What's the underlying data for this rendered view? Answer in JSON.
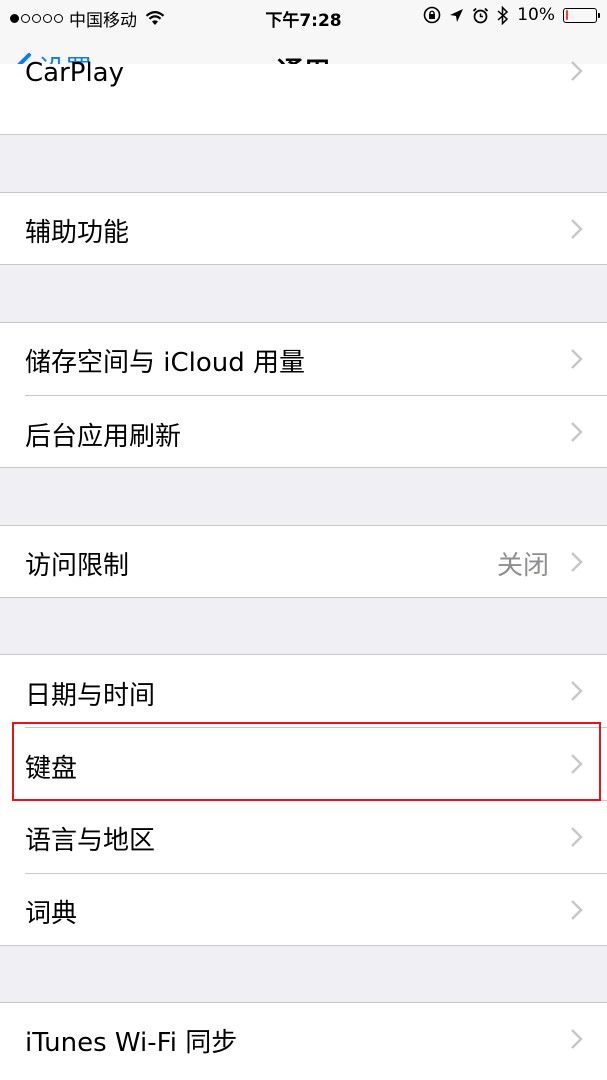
{
  "status_bar": {
    "carrier": "中国移动",
    "time": "下午7:28",
    "battery_percent": "10%",
    "battery_level": 0.1,
    "battery_color": "#ff3b30",
    "icons": [
      "wifi-icon",
      "orientation-lock-icon",
      "location-icon",
      "alarm-icon",
      "bluetooth-icon",
      "battery-icon"
    ]
  },
  "nav": {
    "back_label": "设置",
    "title": "通用"
  },
  "rows": {
    "carplay": "CarPlay",
    "accessibility": "辅助功能",
    "storage": "储存空间与 iCloud 用量",
    "background_refresh": "后台应用刷新",
    "restrictions": "访问限制",
    "restrictions_value": "关闭",
    "date_time": "日期与时间",
    "keyboard": "键盘",
    "language_region": "语言与地区",
    "dictionary": "词典",
    "itunes_wifi_sync": "iTunes Wi-Fi 同步"
  },
  "colors": {
    "accent": "#0a7cf9",
    "highlight_box": "#e8131b"
  }
}
